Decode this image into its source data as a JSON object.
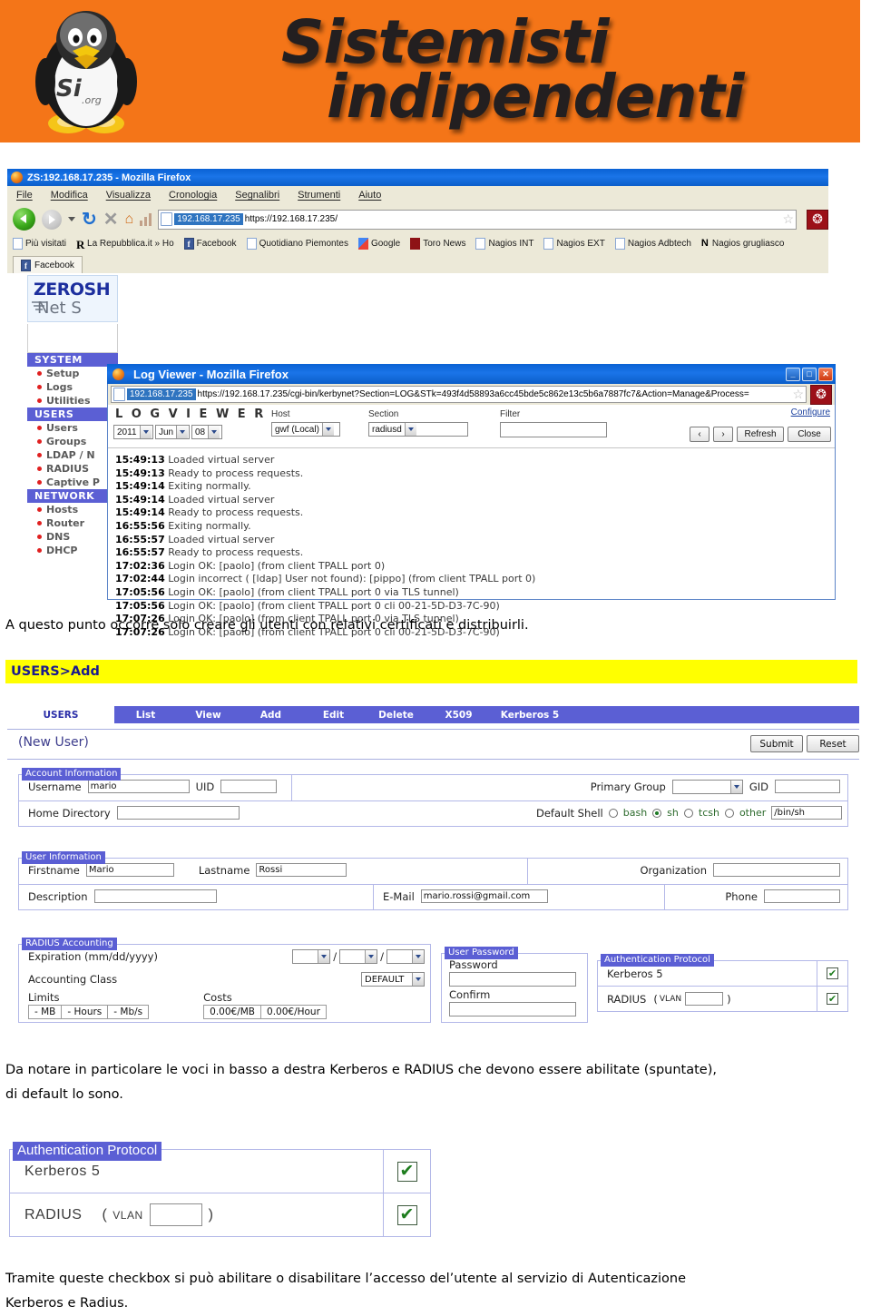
{
  "banner": {
    "line1": "Sistemisti",
    "line2": "indipendenti",
    "logo_alt": "linux-penguin-logo",
    "logo_caption": "Si.org",
    "bg_color": "#f47518"
  },
  "browser": {
    "window_title": "ZS:192.168.17.235 - Mozilla Firefox",
    "menu": [
      "File",
      "Modifica",
      "Visualizza",
      "Cronologia",
      "Segnalibri",
      "Strumenti",
      "Aiuto"
    ],
    "url_host": "192.168.17.235",
    "url_path": "https://192.168.17.235/",
    "bookmarks": [
      {
        "label": "Più visitati",
        "icon": "star-folder-icon"
      },
      {
        "label": "La Repubblica.it » Ho",
        "icon": "repubblica-icon"
      },
      {
        "label": "Facebook",
        "icon": "facebook-icon"
      },
      {
        "label": "Quotidiano Piemontes",
        "icon": "clock-icon"
      },
      {
        "label": "Google",
        "icon": "google-icon"
      },
      {
        "label": "Toro News",
        "icon": "toro-icon"
      },
      {
        "label": "Nagios INT",
        "icon": "page-icon"
      },
      {
        "label": "Nagios EXT",
        "icon": "page-icon"
      },
      {
        "label": "Nagios Adbtech",
        "icon": "page-icon"
      },
      {
        "label": "Nagios grugliasco",
        "icon": "nagios-icon"
      }
    ],
    "tab_label": "Facebook"
  },
  "zeroshell": {
    "logo_line1": "ZEROSH",
    "logo_line2": "Net S",
    "menu": [
      {
        "type": "header",
        "label": "SYSTEM"
      },
      {
        "type": "item",
        "label": "Setup"
      },
      {
        "type": "item",
        "label": "Logs"
      },
      {
        "type": "item",
        "label": "Utilities"
      },
      {
        "type": "header",
        "label": "USERS"
      },
      {
        "type": "item",
        "label": "Users"
      },
      {
        "type": "item",
        "label": "Groups"
      },
      {
        "type": "item",
        "label": "LDAP / N"
      },
      {
        "type": "item",
        "label": "RADIUS"
      },
      {
        "type": "item",
        "label": "Captive P"
      },
      {
        "type": "header",
        "label": "NETWORK"
      },
      {
        "type": "item",
        "label": "Hosts"
      },
      {
        "type": "item",
        "label": "Router"
      },
      {
        "type": "item",
        "label": "DNS"
      },
      {
        "type": "item",
        "label": "DHCP"
      }
    ]
  },
  "logviewer": {
    "window_title": "Log Viewer - Mozilla Firefox",
    "url_host": "192.168.17.235",
    "url_path": "https://192.168.17.235/cgi-bin/kerbynet?Section=LOG&STk=493f4d58893a6cc45bde5c862e13c5b6a7887fc7&Action=Manage&Process=",
    "brand": "L O G  V I E W E R",
    "date_year": "2011",
    "date_month": "Jun",
    "date_day": "08",
    "host_label": "Host",
    "host_value": "gwf (Local)",
    "section_label": "Section",
    "section_value": "radiusd",
    "filter_label": "Filter",
    "filter_value": "",
    "configure_link": "Configure",
    "prev_button": "‹",
    "next_button": "›",
    "refresh_button": "Refresh",
    "close_button": "Close",
    "entries": [
      {
        "time": "15:49:13",
        "message": "Loaded virtual server"
      },
      {
        "time": "15:49:13",
        "message": "Ready to process requests."
      },
      {
        "time": "15:49:14",
        "message": "Exiting normally."
      },
      {
        "time": "15:49:14",
        "message": "Loaded virtual server"
      },
      {
        "time": "15:49:14",
        "message": "Ready to process requests."
      },
      {
        "time": "16:55:56",
        "message": "Exiting normally."
      },
      {
        "time": "16:55:57",
        "message": "Loaded virtual server"
      },
      {
        "time": "16:55:57",
        "message": "Ready to process requests."
      },
      {
        "time": "17:02:36",
        "message": "Login OK: [paolo] (from client TPALL port 0)"
      },
      {
        "time": "17:02:44",
        "message": "Login incorrect ( [ldap] User not found): [pippo] (from client TPALL port 0)"
      },
      {
        "time": "17:05:56",
        "message": "Login OK: [paolo] (from client TPALL port 0 via TLS tunnel)"
      },
      {
        "time": "17:05:56",
        "message": "Login OK: [paolo] (from client TPALL port 0 cli 00-21-5D-D3-7C-90)"
      },
      {
        "time": "17:07:26",
        "message": "Login OK: [paolo] (from client TPALL port 0 via TLS tunnel)"
      },
      {
        "time": "17:07:26",
        "message": "Login OK: [paolo] (from client TPALL port 0 cli 00-21-5D-D3-7C-90)"
      }
    ]
  },
  "text": {
    "para1": "A questo punto occorre solo creare gli utenti con relativi certificati e distribuirli.",
    "highlight": "USERS>Add",
    "para2_line1": "Da notare in particolare le voci in basso a destra Kerberos e RADIUS che devono essere abilitate (spuntate),",
    "para2_line2": "di default lo sono.",
    "para3_line1": "Tramite queste checkbox si può abilitare o disabilitare l’accesso del’utente al servizio di Autenticazione",
    "para3_line2": "Kerberos e Radius."
  },
  "userform": {
    "section_tab": "USERS",
    "tabs": [
      "List",
      "View",
      "Add",
      "Edit",
      "Delete",
      "X509",
      "Kerberos 5"
    ],
    "heading": "(New User)",
    "submit_label": "Submit",
    "reset_label": "Reset",
    "account": {
      "caption": "Account Information",
      "username_label": "Username",
      "username_value": "mario",
      "uid_label": "UID",
      "uid_value": "",
      "home_label": "Home Directory",
      "home_value": "",
      "primary_group_label": "Primary Group",
      "primary_group_value": "",
      "gid_label": "GID",
      "gid_value": "",
      "shell_label": "Default Shell",
      "shell_options": [
        "bash",
        "sh",
        "tcsh",
        "other"
      ],
      "shell_selected": "sh",
      "shell_other_value": "/bin/sh"
    },
    "userinfo": {
      "caption": "User Information",
      "firstname_label": "Firstname",
      "firstname_value": "Mario",
      "lastname_label": "Lastname",
      "lastname_value": "Rossi",
      "organization_label": "Organization",
      "organization_value": "",
      "description_label": "Description",
      "description_value": "",
      "email_label": "E-Mail",
      "email_value": "mario.rossi@gmail.com",
      "phone_label": "Phone",
      "phone_value": ""
    },
    "radius": {
      "caption": "RADIUS Accounting",
      "expiration_label": "Expiration (mm/dd/yyyy)",
      "expiration_mm": "",
      "expiration_dd": "",
      "expiration_yyyy": "",
      "class_label": "Accounting Class",
      "class_value": "DEFAULT",
      "limits_label": "Limits",
      "limits": [
        "- MB",
        "- Hours",
        "- Mb/s"
      ],
      "costs_label": "Costs",
      "costs": [
        "0.00€/MB",
        "0.00€/Hour"
      ]
    },
    "password": {
      "caption": "User Password",
      "password_label": "Password",
      "password_value": "",
      "confirm_label": "Confirm",
      "confirm_value": ""
    },
    "auth": {
      "caption": "Authentication Protocol",
      "kerberos_label": "Kerberos 5",
      "kerberos_checked": "✔",
      "radius_label": "RADIUS",
      "radius_vlan_open": "(",
      "radius_vlan_label": "VLAN",
      "radius_vlan_close": ")",
      "radius_vlan_value": "",
      "radius_checked": "✔"
    }
  },
  "auth_zoom": {
    "caption": "Authentication Protocol",
    "kerberos_label": "Kerberos 5",
    "radius_label": "RADIUS",
    "vlan_open": "(",
    "vlan_label": "VLAN",
    "vlan_close": ")",
    "vlan_value": ""
  },
  "colors": {
    "banner_orange": "#f47518",
    "zeroshell_blue": "#5b5fd4",
    "highlight_yellow": "#ffff00",
    "titlebar_blue": "#1a74e8",
    "check_green": "#1e7d1e"
  }
}
